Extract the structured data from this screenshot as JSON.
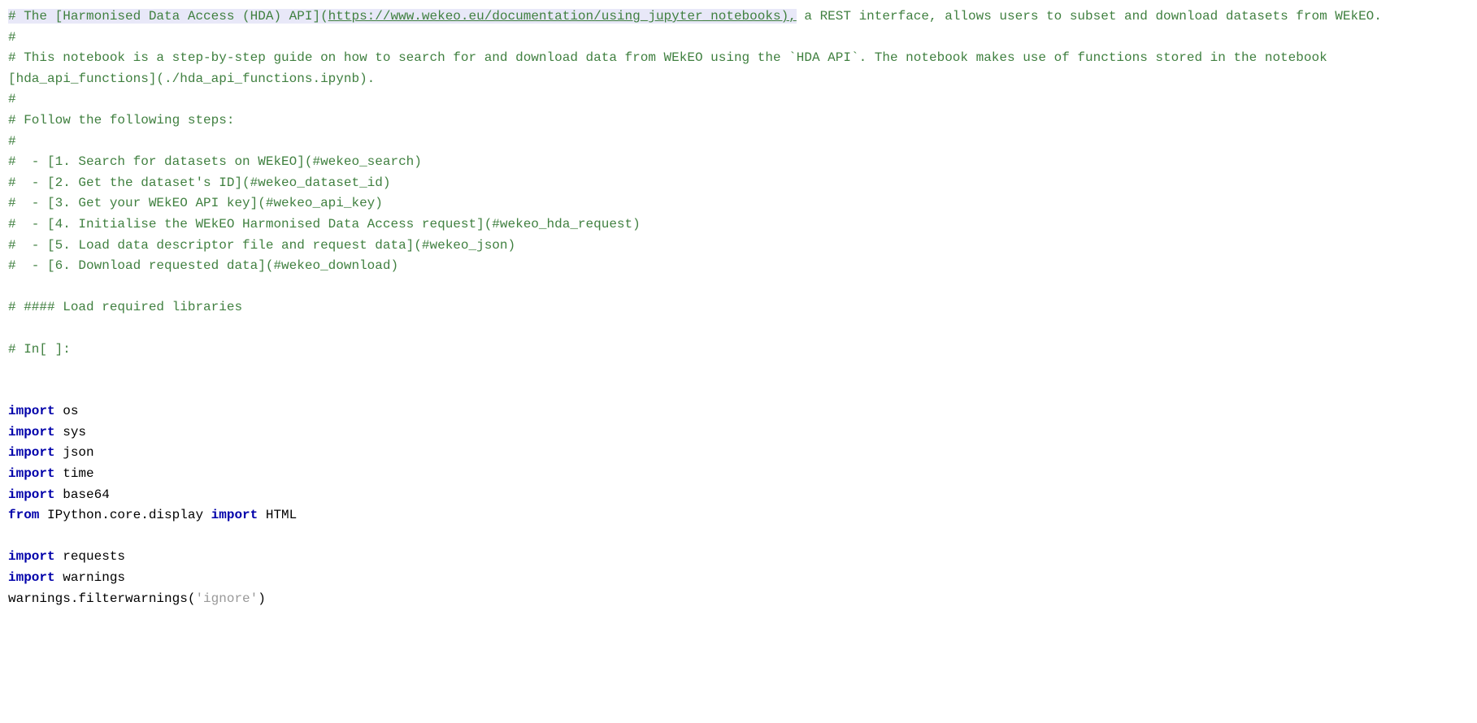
{
  "comments": {
    "line1_prefix": "# The [Harmonised Data Access (HDA) API](",
    "line1_url": "https://www.wekeo.eu/documentation/using_jupyter_notebooks),",
    "line1_suffix": " a REST interface, allows users to subset and download datasets from WEkEO.",
    "line2": "#",
    "line3": "# This notebook is a step-by-step guide on how to search for and download data from WEkEO using the `HDA API`. The notebook makes use of functions stored in the notebook [hda_api_functions](./hda_api_functions.ipynb).",
    "line4": "#",
    "line5": "# Follow the following steps:",
    "line6": "#",
    "step1": "#  - [1. Search for datasets on WEkEO](#wekeo_search)",
    "step2": "#  - [2. Get the dataset's ID](#wekeo_dataset_id)",
    "step3": "#  - [3. Get your WEkEO API key](#wekeo_api_key)",
    "step4": "#  - [4. Initialise the WEkEO Harmonised Data Access request](#wekeo_hda_request)",
    "step5": "#  - [5. Load data descriptor file and request data](#wekeo_json)",
    "step6": "#  - [6. Download requested data](#wekeo_download)",
    "load_libs": "# #### Load required libraries",
    "in_cell": "# In[ ]:"
  },
  "code": {
    "import_kw": "import",
    "from_kw": "from",
    "os": " os",
    "sys": " sys",
    "json": " json",
    "time": " time",
    "base64": " base64",
    "ipython": " IPython.core.display ",
    "html": " HTML",
    "requests": " requests",
    "warnings": " warnings",
    "filterwarnings": "warnings.filterwarnings(",
    "ignore": "'ignore'",
    "close_paren": ")"
  }
}
